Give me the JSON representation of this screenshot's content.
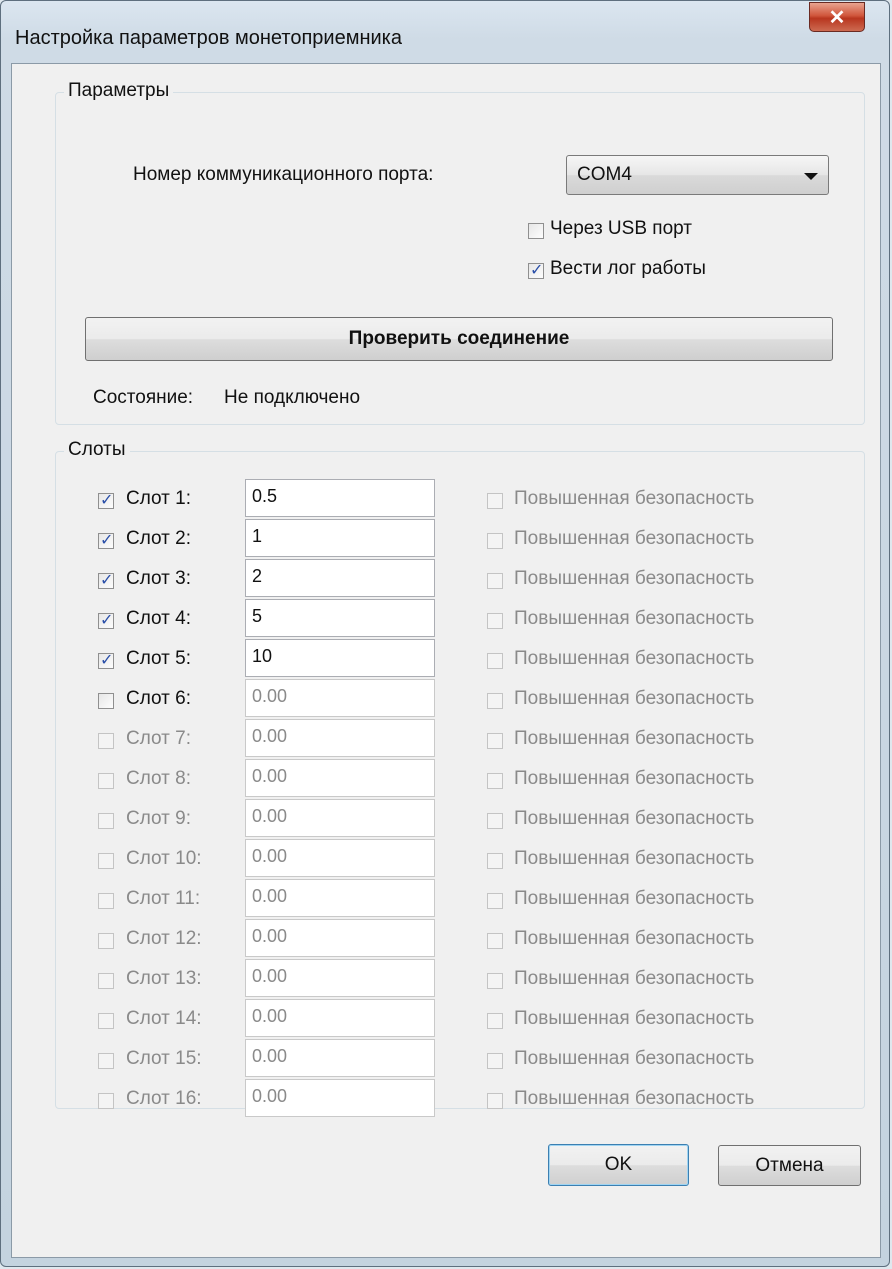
{
  "window": {
    "title": "Настройка параметров монетоприемника",
    "close_glyph": "✕"
  },
  "params": {
    "group_label": "Параметры",
    "port_label": "Номер коммуникационного порта:",
    "port_value": "COM4",
    "usb_label": "Через USB порт",
    "usb_checked": false,
    "log_label": "Вести лог работы",
    "log_checked": true,
    "check_button": "Проверить соединение",
    "status_label": "Состояние:",
    "status_value": "Не подключено"
  },
  "slots": {
    "group_label": "Слоты",
    "items": [
      {
        "label": "Слот 1:",
        "value": "0.5",
        "checked": true,
        "enabled": true,
        "security": "Повышенная безопасность"
      },
      {
        "label": "Слот 2:",
        "value": "1",
        "checked": true,
        "enabled": true,
        "security": "Повышенная безопасность"
      },
      {
        "label": "Слот 3:",
        "value": "2",
        "checked": true,
        "enabled": true,
        "security": "Повышенная безопасность"
      },
      {
        "label": "Слот 4:",
        "value": "5",
        "checked": true,
        "enabled": true,
        "security": "Повышенная безопасность"
      },
      {
        "label": "Слот 5:",
        "value": "10",
        "checked": true,
        "enabled": true,
        "security": "Повышенная безопасность"
      },
      {
        "label": "Слот 6:",
        "value": "0.00",
        "checked": false,
        "enabled": true,
        "security": "Повышенная безопасность"
      },
      {
        "label": "Слот 7:",
        "value": "0.00",
        "checked": false,
        "enabled": false,
        "security": "Повышенная безопасность"
      },
      {
        "label": "Слот 8:",
        "value": "0.00",
        "checked": false,
        "enabled": false,
        "security": "Повышенная безопасность"
      },
      {
        "label": "Слот 9:",
        "value": "0.00",
        "checked": false,
        "enabled": false,
        "security": "Повышенная безопасность"
      },
      {
        "label": "Слот 10:",
        "value": "0.00",
        "checked": false,
        "enabled": false,
        "security": "Повышенная безопасность"
      },
      {
        "label": "Слот 11:",
        "value": "0.00",
        "checked": false,
        "enabled": false,
        "security": "Повышенная безопасность"
      },
      {
        "label": "Слот 12:",
        "value": "0.00",
        "checked": false,
        "enabled": false,
        "security": "Повышенная безопасность"
      },
      {
        "label": "Слот 13:",
        "value": "0.00",
        "checked": false,
        "enabled": false,
        "security": "Повышенная безопасность"
      },
      {
        "label": "Слот 14:",
        "value": "0.00",
        "checked": false,
        "enabled": false,
        "security": "Повышенная безопасность"
      },
      {
        "label": "Слот 15:",
        "value": "0.00",
        "checked": false,
        "enabled": false,
        "security": "Повышенная безопасность"
      },
      {
        "label": "Слот 16:",
        "value": "0.00",
        "checked": false,
        "enabled": false,
        "security": "Повышенная безопасность"
      }
    ]
  },
  "buttons": {
    "ok": "OK",
    "cancel": "Отмена"
  }
}
